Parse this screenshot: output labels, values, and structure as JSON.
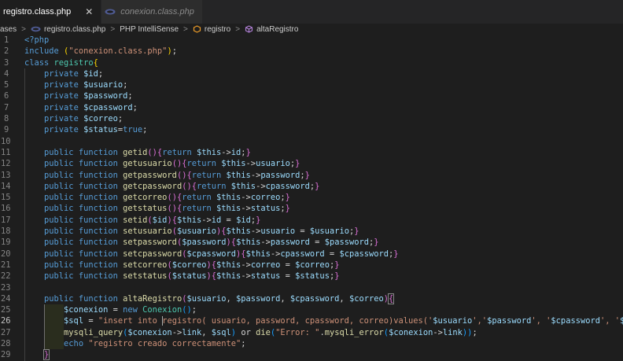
{
  "tabs": [
    {
      "label": "registro.class.php",
      "active": true,
      "close": "✕"
    },
    {
      "label": "conexion.class.php",
      "active": false
    }
  ],
  "breadcrumb": {
    "items": [
      "ases",
      "registro.class.php",
      "PHP IntelliSense",
      "registro",
      "altaRegistro"
    ],
    "separator": ">"
  },
  "editor": {
    "current_line": 26,
    "lines": [
      {
        "n": "1",
        "tokens": [
          [
            "kw",
            "<?php"
          ]
        ]
      },
      {
        "n": "2",
        "tokens": [
          [
            "kw",
            "include "
          ],
          [
            "br1",
            "("
          ],
          [
            "str",
            "\"conexion.class.php\""
          ],
          [
            "br1",
            ")"
          ],
          [
            "pl",
            ";"
          ]
        ]
      },
      {
        "n": "3",
        "tokens": [
          [
            "kw",
            "class "
          ],
          [
            "cls",
            "registro"
          ],
          [
            "br1",
            "{"
          ]
        ]
      },
      {
        "n": "4",
        "tokens": [
          [
            "pl",
            "    "
          ],
          [
            "kw",
            "private "
          ],
          [
            "var",
            "$id"
          ],
          [
            "pl",
            ";"
          ]
        ]
      },
      {
        "n": "5",
        "tokens": [
          [
            "pl",
            "    "
          ],
          [
            "kw",
            "private "
          ],
          [
            "var",
            "$usuario"
          ],
          [
            "pl",
            ";"
          ]
        ]
      },
      {
        "n": "6",
        "tokens": [
          [
            "pl",
            "    "
          ],
          [
            "kw",
            "private "
          ],
          [
            "var",
            "$password"
          ],
          [
            "pl",
            ";"
          ]
        ]
      },
      {
        "n": "7",
        "tokens": [
          [
            "pl",
            "    "
          ],
          [
            "kw",
            "private "
          ],
          [
            "var",
            "$cpassword"
          ],
          [
            "pl",
            ";"
          ]
        ]
      },
      {
        "n": "8",
        "tokens": [
          [
            "pl",
            "    "
          ],
          [
            "kw",
            "private "
          ],
          [
            "var",
            "$correo"
          ],
          [
            "pl",
            ";"
          ]
        ]
      },
      {
        "n": "9",
        "tokens": [
          [
            "pl",
            "    "
          ],
          [
            "kw",
            "private "
          ],
          [
            "var",
            "$status"
          ],
          [
            "pl",
            "="
          ],
          [
            "kw",
            "true"
          ],
          [
            "pl",
            ";"
          ]
        ]
      },
      {
        "n": "10",
        "tokens": []
      },
      {
        "n": "11",
        "tokens": [
          [
            "pl",
            "    "
          ],
          [
            "kw",
            "public function "
          ],
          [
            "fn",
            "getid"
          ],
          [
            "br2",
            "()"
          ],
          [
            "br2",
            "{"
          ],
          [
            "kw",
            "return "
          ],
          [
            "var",
            "$this"
          ],
          [
            "pl",
            "->"
          ],
          [
            "var",
            "id"
          ],
          [
            "pl",
            ";"
          ],
          [
            "br2",
            "}"
          ]
        ]
      },
      {
        "n": "12",
        "tokens": [
          [
            "pl",
            "    "
          ],
          [
            "kw",
            "public function "
          ],
          [
            "fn",
            "getusuario"
          ],
          [
            "br2",
            "()"
          ],
          [
            "br2",
            "{"
          ],
          [
            "kw",
            "return "
          ],
          [
            "var",
            "$this"
          ],
          [
            "pl",
            "->"
          ],
          [
            "var",
            "usuario"
          ],
          [
            "pl",
            ";"
          ],
          [
            "br2",
            "}"
          ]
        ]
      },
      {
        "n": "13",
        "tokens": [
          [
            "pl",
            "    "
          ],
          [
            "kw",
            "public function "
          ],
          [
            "fn",
            "getpassword"
          ],
          [
            "br2",
            "()"
          ],
          [
            "br2",
            "{"
          ],
          [
            "kw",
            "return "
          ],
          [
            "var",
            "$this"
          ],
          [
            "pl",
            "->"
          ],
          [
            "var",
            "password"
          ],
          [
            "pl",
            ";"
          ],
          [
            "br2",
            "}"
          ]
        ]
      },
      {
        "n": "14",
        "tokens": [
          [
            "pl",
            "    "
          ],
          [
            "kw",
            "public function "
          ],
          [
            "fn",
            "getcpassword"
          ],
          [
            "br2",
            "()"
          ],
          [
            "br2",
            "{"
          ],
          [
            "kw",
            "return "
          ],
          [
            "var",
            "$this"
          ],
          [
            "pl",
            "->"
          ],
          [
            "var",
            "cpassword"
          ],
          [
            "pl",
            ";"
          ],
          [
            "br2",
            "}"
          ]
        ]
      },
      {
        "n": "15",
        "tokens": [
          [
            "pl",
            "    "
          ],
          [
            "kw",
            "public function "
          ],
          [
            "fn",
            "getcorreo"
          ],
          [
            "br2",
            "()"
          ],
          [
            "br2",
            "{"
          ],
          [
            "kw",
            "return "
          ],
          [
            "var",
            "$this"
          ],
          [
            "pl",
            "->"
          ],
          [
            "var",
            "correo"
          ],
          [
            "pl",
            ";"
          ],
          [
            "br2",
            "}"
          ]
        ]
      },
      {
        "n": "16",
        "tokens": [
          [
            "pl",
            "    "
          ],
          [
            "kw",
            "public function "
          ],
          [
            "fn",
            "getstatus"
          ],
          [
            "br2",
            "()"
          ],
          [
            "br2",
            "{"
          ],
          [
            "kw",
            "return "
          ],
          [
            "var",
            "$this"
          ],
          [
            "pl",
            "->"
          ],
          [
            "var",
            "status"
          ],
          [
            "pl",
            ";"
          ],
          [
            "br2",
            "}"
          ]
        ]
      },
      {
        "n": "17",
        "tokens": [
          [
            "pl",
            "    "
          ],
          [
            "kw",
            "public function "
          ],
          [
            "fn",
            "setid"
          ],
          [
            "br2",
            "("
          ],
          [
            "var",
            "$id"
          ],
          [
            "br2",
            ")"
          ],
          [
            "br2",
            "{"
          ],
          [
            "var",
            "$this"
          ],
          [
            "pl",
            "->"
          ],
          [
            "var",
            "id"
          ],
          [
            "pl",
            " = "
          ],
          [
            "var",
            "$id"
          ],
          [
            "pl",
            ";"
          ],
          [
            "br2",
            "}"
          ]
        ]
      },
      {
        "n": "18",
        "tokens": [
          [
            "pl",
            "    "
          ],
          [
            "kw",
            "public function "
          ],
          [
            "fn",
            "setusuario"
          ],
          [
            "br2",
            "("
          ],
          [
            "var",
            "$usuario"
          ],
          [
            "br2",
            ")"
          ],
          [
            "br2",
            "{"
          ],
          [
            "var",
            "$this"
          ],
          [
            "pl",
            "->"
          ],
          [
            "var",
            "usuario"
          ],
          [
            "pl",
            " = "
          ],
          [
            "var",
            "$usuario"
          ],
          [
            "pl",
            ";"
          ],
          [
            "br2",
            "}"
          ]
        ]
      },
      {
        "n": "19",
        "tokens": [
          [
            "pl",
            "    "
          ],
          [
            "kw",
            "public function "
          ],
          [
            "fn",
            "setpassword"
          ],
          [
            "br2",
            "("
          ],
          [
            "var",
            "$password"
          ],
          [
            "br2",
            ")"
          ],
          [
            "br2",
            "{"
          ],
          [
            "var",
            "$this"
          ],
          [
            "pl",
            "->"
          ],
          [
            "var",
            "password"
          ],
          [
            "pl",
            " = "
          ],
          [
            "var",
            "$password"
          ],
          [
            "pl",
            ";"
          ],
          [
            "br2",
            "}"
          ]
        ]
      },
      {
        "n": "20",
        "tokens": [
          [
            "pl",
            "    "
          ],
          [
            "kw",
            "public function "
          ],
          [
            "fn",
            "setcpassword"
          ],
          [
            "br2",
            "("
          ],
          [
            "var",
            "$cpassword"
          ],
          [
            "br2",
            ")"
          ],
          [
            "br2",
            "{"
          ],
          [
            "var",
            "$this"
          ],
          [
            "pl",
            "->"
          ],
          [
            "var",
            "cpassword"
          ],
          [
            "pl",
            " = "
          ],
          [
            "var",
            "$cpassword"
          ],
          [
            "pl",
            ";"
          ],
          [
            "br2",
            "}"
          ]
        ]
      },
      {
        "n": "21",
        "tokens": [
          [
            "pl",
            "    "
          ],
          [
            "kw",
            "public function "
          ],
          [
            "fn",
            "setcorreo"
          ],
          [
            "br2",
            "("
          ],
          [
            "var",
            "$correo"
          ],
          [
            "br2",
            ")"
          ],
          [
            "br2",
            "{"
          ],
          [
            "var",
            "$this"
          ],
          [
            "pl",
            "->"
          ],
          [
            "var",
            "correo"
          ],
          [
            "pl",
            " = "
          ],
          [
            "var",
            "$correo"
          ],
          [
            "pl",
            ";"
          ],
          [
            "br2",
            "}"
          ]
        ]
      },
      {
        "n": "22",
        "tokens": [
          [
            "pl",
            "    "
          ],
          [
            "kw",
            "public function "
          ],
          [
            "fn",
            "setstatus"
          ],
          [
            "br2",
            "("
          ],
          [
            "var",
            "$status"
          ],
          [
            "br2",
            ")"
          ],
          [
            "br2",
            "{"
          ],
          [
            "var",
            "$this"
          ],
          [
            "pl",
            "->"
          ],
          [
            "var",
            "status"
          ],
          [
            "pl",
            " = "
          ],
          [
            "var",
            "$status"
          ],
          [
            "pl",
            ";"
          ],
          [
            "br2",
            "}"
          ]
        ]
      },
      {
        "n": "23",
        "tokens": []
      },
      {
        "n": "24",
        "tokens": [
          [
            "pl",
            "    "
          ],
          [
            "kw",
            "public function "
          ],
          [
            "fn",
            "altaRegistro"
          ],
          [
            "br2",
            "("
          ],
          [
            "var",
            "$usuario"
          ],
          [
            "pl",
            ", "
          ],
          [
            "var",
            "$password"
          ],
          [
            "pl",
            ", "
          ],
          [
            "var",
            "$cpassword"
          ],
          [
            "pl",
            ", "
          ],
          [
            "var",
            "$correo"
          ],
          [
            "br2",
            ")"
          ],
          [
            "br2",
            "{"
          ]
        ]
      },
      {
        "n": "25",
        "tokens": [
          [
            "pl",
            "        "
          ],
          [
            "var",
            "$conexion"
          ],
          [
            "pl",
            " = "
          ],
          [
            "kw",
            "new "
          ],
          [
            "cls",
            "Conexion"
          ],
          [
            "br3",
            "()"
          ],
          [
            "pl",
            ";"
          ]
        ]
      },
      {
        "n": "26",
        "tokens": [
          [
            "pl",
            "        "
          ],
          [
            "var",
            "$sql"
          ],
          [
            "pl",
            " = "
          ],
          [
            "str",
            "\"insert into registro( usuario, password, cpassword, correo)values('"
          ],
          [
            "var",
            "$usuario"
          ],
          [
            "str",
            "','"
          ],
          [
            "var",
            "$password"
          ],
          [
            "str",
            "', '"
          ],
          [
            "var",
            "$cpassword"
          ],
          [
            "str",
            "', '"
          ],
          [
            "var",
            "$correo"
          ],
          [
            "str",
            "')\""
          ],
          [
            "pl",
            ";"
          ]
        ]
      },
      {
        "n": "27",
        "tokens": [
          [
            "pl",
            "        "
          ],
          [
            "fn",
            "mysqli_query"
          ],
          [
            "br3",
            "("
          ],
          [
            "var",
            "$conexion"
          ],
          [
            "pl",
            "->"
          ],
          [
            "var",
            "link"
          ],
          [
            "pl",
            ", "
          ],
          [
            "var",
            "$sql"
          ],
          [
            "br3",
            ")"
          ],
          [
            "pl",
            " or "
          ],
          [
            "fn",
            "die"
          ],
          [
            "br3",
            "("
          ],
          [
            "str",
            "\"Error: \""
          ],
          [
            "pl",
            "."
          ],
          [
            "fn",
            "mysqli_error"
          ],
          [
            "br3",
            "("
          ],
          [
            "var",
            "$conexion"
          ],
          [
            "pl",
            "->"
          ],
          [
            "var",
            "link"
          ],
          [
            "br3",
            "))"
          ],
          [
            "pl",
            ";"
          ]
        ]
      },
      {
        "n": "28",
        "tokens": [
          [
            "pl",
            "        "
          ],
          [
            "kw",
            "echo "
          ],
          [
            "str",
            "\"registro creado correctamente\""
          ],
          [
            "pl",
            ";"
          ]
        ]
      },
      {
        "n": "29",
        "tokens": [
          [
            "pl",
            "    "
          ],
          [
            "br2",
            "}"
          ]
        ]
      }
    ]
  },
  "colors": {
    "background": "#1e1e1e",
    "keyword": "#569cd6",
    "function": "#dcdcaa",
    "class": "#4ec9b0",
    "variable": "#9cdcfe",
    "string": "#ce9178"
  }
}
